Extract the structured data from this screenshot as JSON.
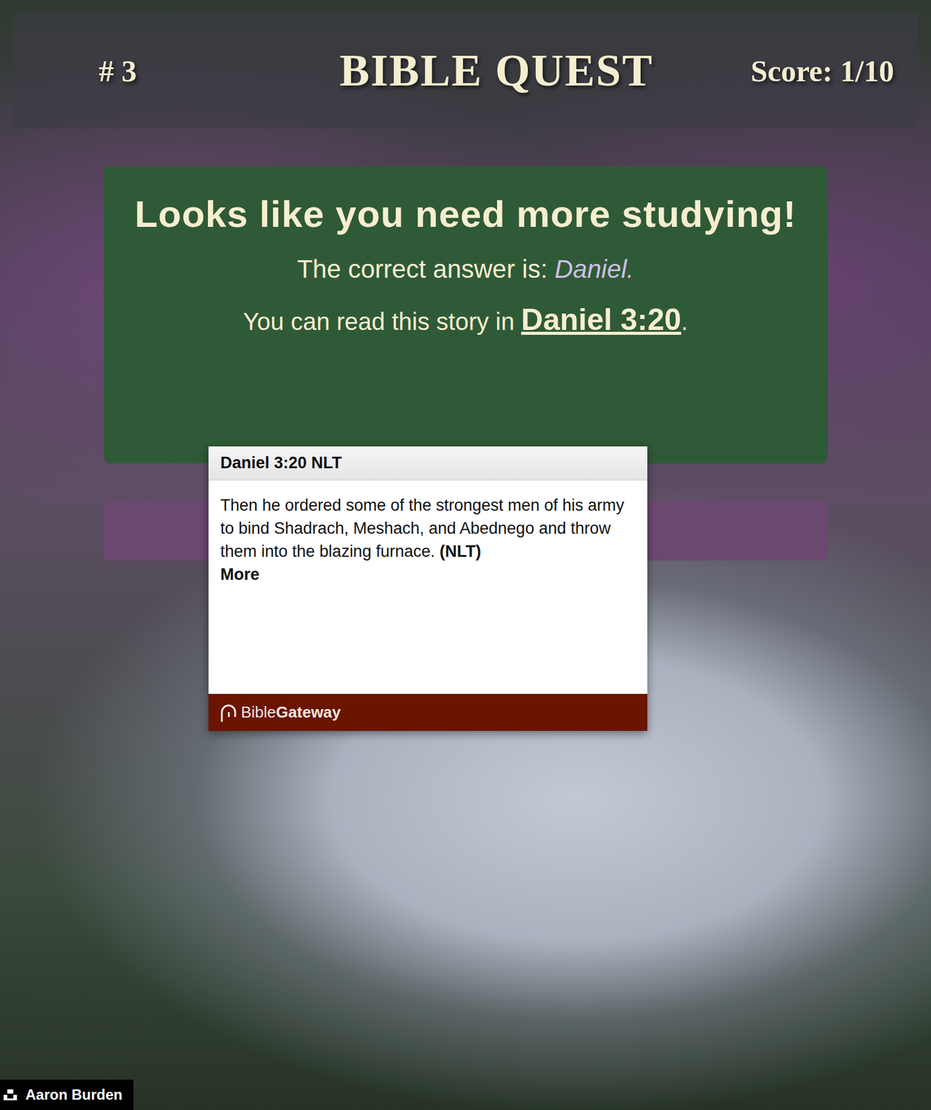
{
  "header": {
    "number": "# 3",
    "title": "BIBLE QUEST",
    "score": "Score: 1/10"
  },
  "result": {
    "heading": "Looks like you need more studying!",
    "answer_label": "The correct answer is:",
    "answer": "Daniel.",
    "reference_prefix": "You can read this story in",
    "reference": "Daniel 3:20",
    "reference_suffix": "."
  },
  "tooltip": {
    "title": "Daniel 3:20 NLT",
    "text": "Then he ordered some of the strongest men of his army to bind Shadrach, Meshach, and Abednego and throw them into the blazing furnace.",
    "version": "(NLT)",
    "more": "More",
    "brand_light": "Bible",
    "brand_bold": "Gateway"
  },
  "credit": {
    "author": "Aaron Burden"
  }
}
